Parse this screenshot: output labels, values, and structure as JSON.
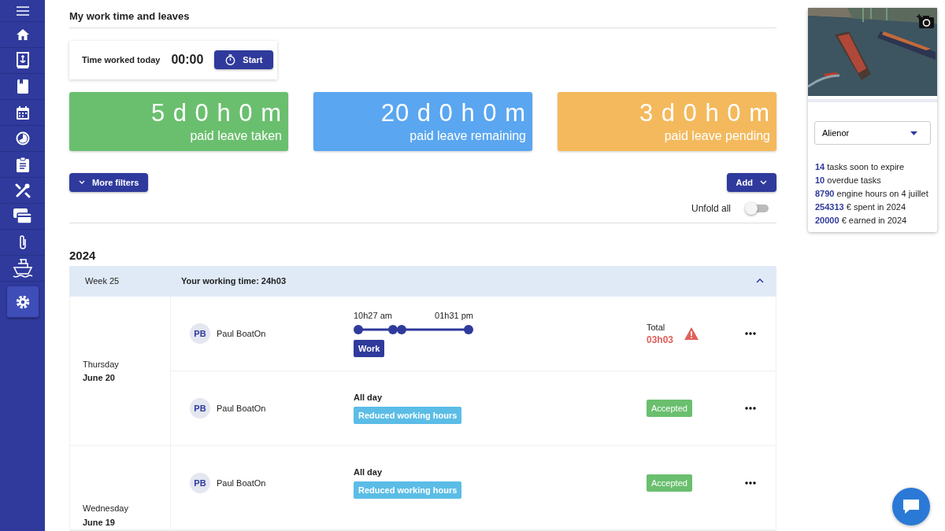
{
  "sidebar": {
    "items": [
      {
        "selected": false
      },
      {
        "selected": false
      },
      {
        "selected": false
      },
      {
        "selected": false
      },
      {
        "selected": false
      },
      {
        "selected": false
      },
      {
        "selected": false
      },
      {
        "selected": false
      },
      {
        "selected": false
      },
      {
        "selected": false
      },
      {
        "selected": true
      }
    ]
  },
  "page_title": "My work time and leaves",
  "timer": {
    "label": "Time worked today",
    "value": "00:00",
    "button": "Start"
  },
  "summary": [
    {
      "value": "5 d 0 h 0 m",
      "label": "paid leave taken",
      "color": "#6abf6e"
    },
    {
      "value": "20 d 0 h 0 m",
      "label": "paid leave remaining",
      "color": "#5aa6f0"
    },
    {
      "value": "3 d 0 h 0 m",
      "label": "paid leave pending",
      "color": "#f3b95c"
    }
  ],
  "filters_button": "More filters",
  "add_button": "Add",
  "unfold": {
    "label": "Unfold all",
    "on": false
  },
  "year": "2024",
  "week": {
    "label": "Week 25",
    "total": "Your working time: 24h03",
    "expanded": true
  },
  "days": [
    {
      "weekday": "Thursday",
      "date": "June 20",
      "entries": [
        {
          "kind": "shift",
          "initials": "PB",
          "name": "Paul BoatOn",
          "start": "10h27 am",
          "end": "01h31 pm",
          "tag": "Work",
          "total_label": "Total",
          "total": "03h03",
          "warning": true
        },
        {
          "kind": "leave",
          "initials": "PB",
          "name": "Paul BoatOn",
          "period": "All day",
          "tag": "Reduced working hours",
          "status": "Accepted"
        }
      ]
    },
    {
      "weekday": "Wednesday",
      "date": "June 19",
      "entries": [
        {
          "kind": "leave",
          "initials": "PB",
          "name": "Paul BoatOn",
          "period": "All day",
          "tag": "Reduced working hours",
          "status": "Accepted"
        }
      ]
    }
  ],
  "boat_card": {
    "select": "Alienor",
    "stats": [
      "**14** tasks soon to expire",
      "**10** overdue tasks",
      "**8790** engine hours on 4 juillet",
      "**254313** € spent in 2024",
      "**20000** € earned in 2024"
    ]
  }
}
